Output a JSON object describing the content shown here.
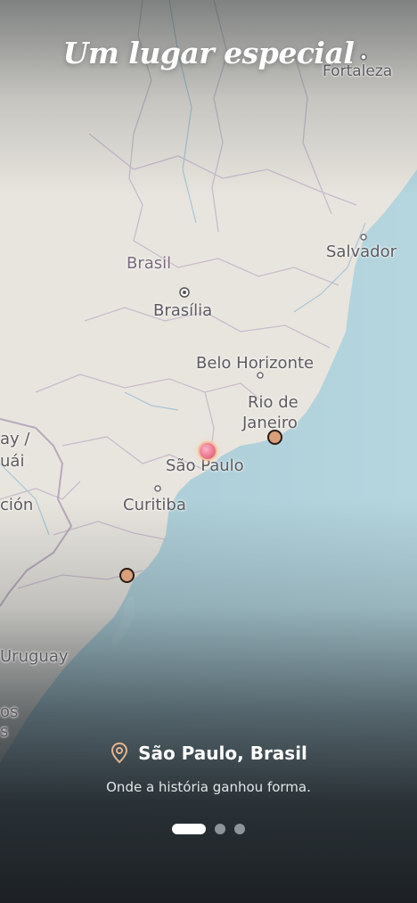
{
  "title": "Um lugar especial",
  "map": {
    "labels": {
      "fortaleza": "Fortaleza",
      "brasil": "Brasil",
      "brasilia": "Brasília",
      "salvador": "Salvador",
      "belo_horizonte": "Belo Horizonte",
      "rio_line1": "Rio de",
      "rio_line2": "Janeiro",
      "sao_paulo": "São Paulo",
      "curitiba": "Curitiba",
      "paraguay_partial": "ay /",
      "paraguai_partial": "uái",
      "asuncion_partial": "ción",
      "uruguay_partial": "Uruguay",
      "os_partial": "os",
      "s_partial": "s"
    }
  },
  "location": {
    "icon": "map-pin-icon",
    "text": "São Paulo, Brasil"
  },
  "subtitle": "Onde a história ganhou forma.",
  "pagination": {
    "total": 3,
    "current": 1
  },
  "colors": {
    "accent": "#d9a07a",
    "active_marker": "#e8788f",
    "ocean": "#9cc1cc",
    "land": "#e9e6df",
    "background": "#1e2428"
  }
}
